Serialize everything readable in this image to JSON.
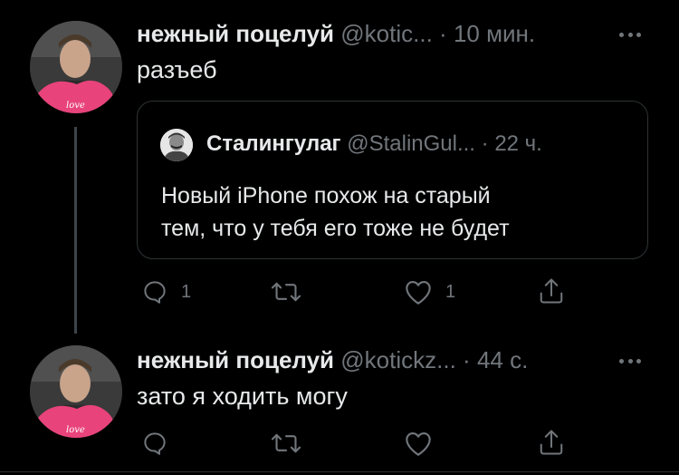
{
  "tweets": [
    {
      "author": {
        "name": "нежный поцелуй",
        "handle": "@kotic...",
        "avatar_icon": "avatar-photo"
      },
      "time": "10 мин.",
      "text": "разъеб",
      "quote": {
        "author": {
          "name": "Сталингулаг",
          "handle": "@StalinGul...",
          "avatar_icon": "avatar-portrait"
        },
        "time": "22 ч.",
        "text": "Новый iPhone похож на старый\nтем, что у тебя его тоже не будет"
      },
      "actions": {
        "reply_count": "1",
        "retweet_count": "",
        "like_count": "1"
      }
    },
    {
      "author": {
        "name": "нежный поцелуй",
        "handle": "@kotickz...",
        "avatar_icon": "avatar-photo"
      },
      "time": "44 с.",
      "text": "зато я ходить могу",
      "actions": {
        "reply_count": "",
        "retweet_count": "",
        "like_count": ""
      }
    }
  ],
  "separator": "·",
  "colors": {
    "background": "#000000",
    "muted": "#71767b",
    "text": "#e7e9ea",
    "border": "#2f3336",
    "avatar_pink": "#e8437a"
  }
}
